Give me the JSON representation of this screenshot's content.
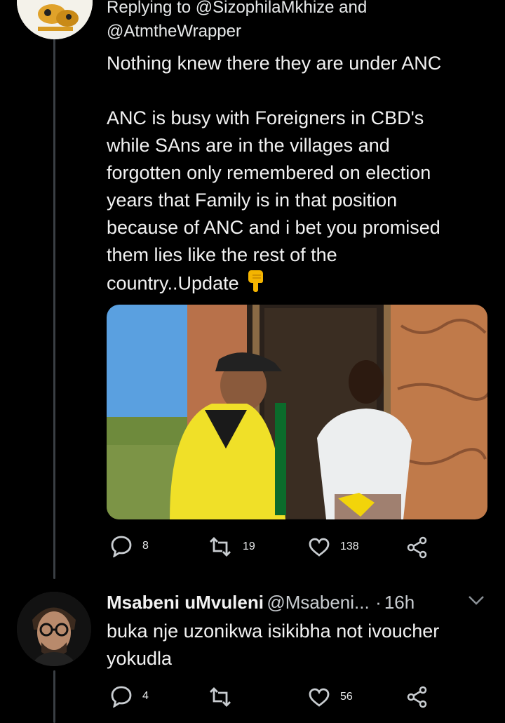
{
  "tweet": {
    "reply_line1": "Replying to @SizophilaMkhize and",
    "reply_line2": "@AtmtheWrapper",
    "text": "Nothing knew there they are under ANC\n\nANC is busy with Foreigners in CBD's\nwhile SAns are in the villages and\nforgotten only remembered on election\nyears that Family is in that position\nbecause of ANC and i bet you promised\nthem lies like the rest of the\ncountry..Update",
    "emoji_icon": "pointing-down-hand-emoji",
    "replies": "8",
    "retweets": "19",
    "likes": "138"
  },
  "reply": {
    "name": "Msabeni uMvuleni",
    "handle": "@Msabeni...",
    "time": "16h",
    "text": "buka nje uzonikwa isikibha not ivoucher\nyokudla",
    "replies": "4",
    "retweets": "",
    "likes": "56"
  },
  "colors": {
    "background": "#000000",
    "text": "#e7e9ea",
    "muted": "#c9cdd1",
    "thread_line": "#3a3f44",
    "emoji": "#f4b400"
  }
}
